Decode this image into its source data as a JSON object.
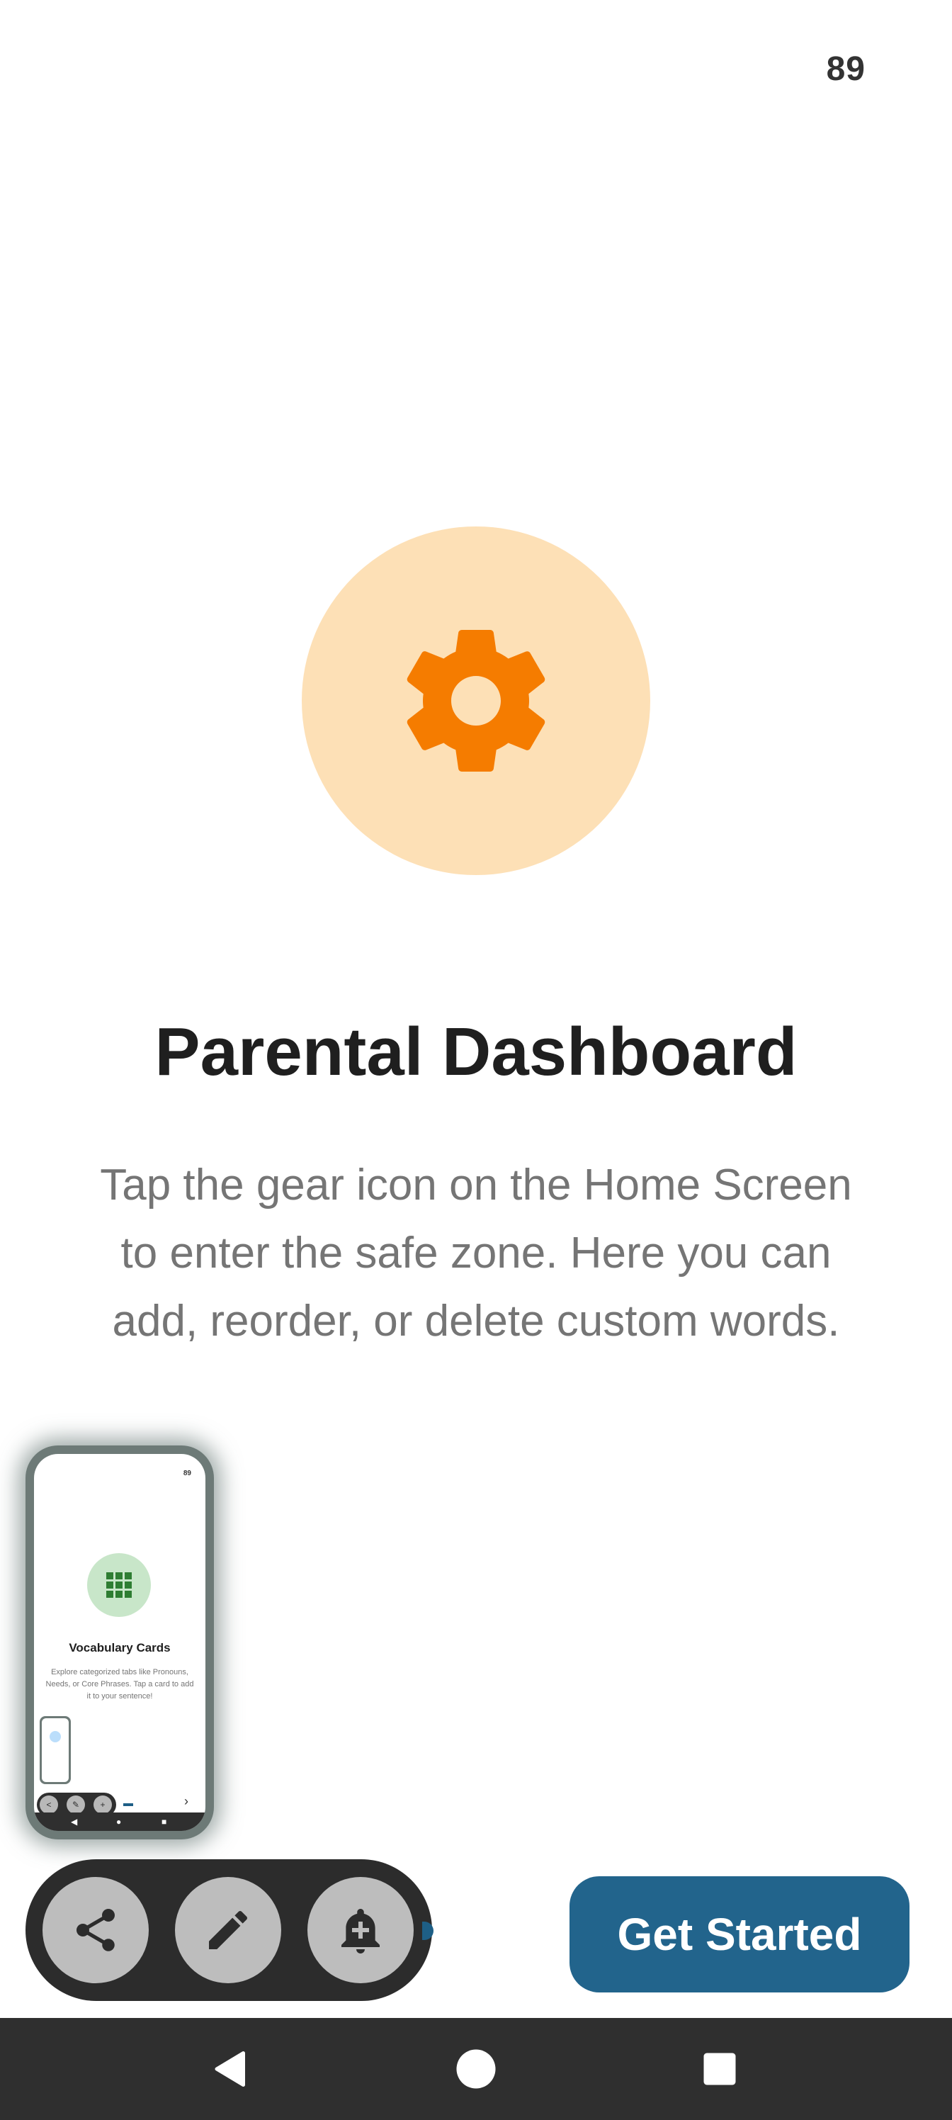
{
  "status_bar": {
    "time": "89"
  },
  "onboarding": {
    "icon": "gear-icon",
    "icon_color": "#f57c00",
    "circle_color": "#fde0b6",
    "title": "Parental Dashboard",
    "description": "Tap the gear icon on the Home Screen to enter the safe zone. Here you can add, reorder, or delete custom words."
  },
  "recent_thumbnail": {
    "time": "89",
    "icon": "grid-icon",
    "title": "Vocabulary Cards",
    "description": "Explore categorized tabs like Pronouns, Needs, or Core Phrases. Tap a card to add it to your sentence!"
  },
  "floating_actions": {
    "items": [
      {
        "icon": "share-icon"
      },
      {
        "icon": "pencil-icon"
      },
      {
        "icon": "add-alert-icon"
      }
    ]
  },
  "primary_button": {
    "label": "Get Started",
    "color": "#22648c"
  },
  "navigation": {
    "back": "back-icon",
    "home": "home-icon",
    "recents": "recents-icon"
  }
}
